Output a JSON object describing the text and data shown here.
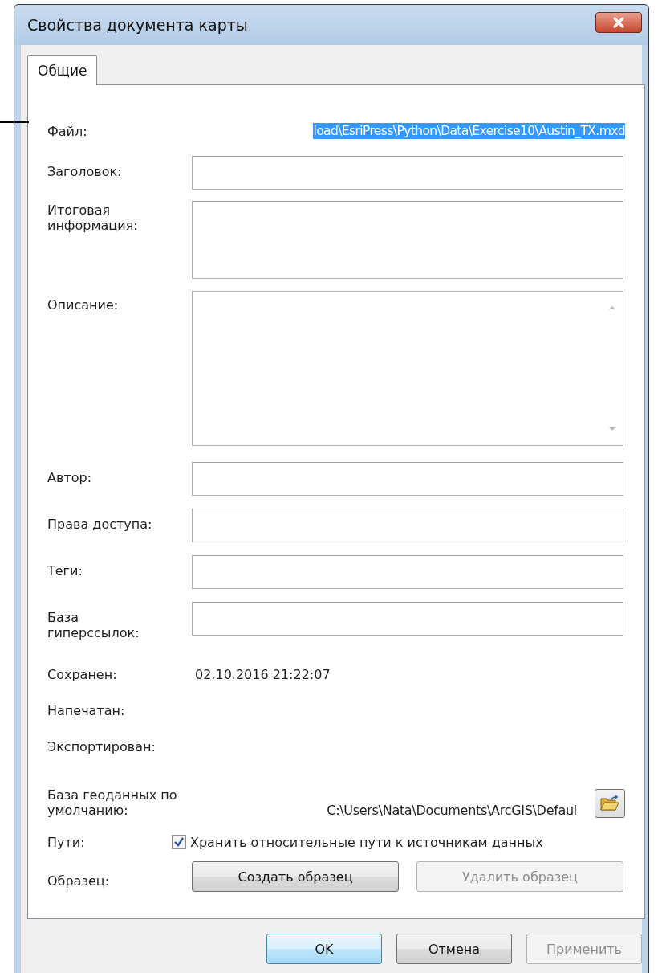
{
  "window": {
    "title": "Свойства документа карты"
  },
  "tabs": [
    {
      "label": "Общие",
      "selected": true
    }
  ],
  "fields": [
    {
      "kind": "selected-text",
      "label": "Файл:",
      "value": "load\\EsriPress\\Python\\Data\\Exercise10\\Austin_TX.mxd"
    },
    {
      "kind": "input",
      "label": "Заголовок:"
    },
    {
      "kind": "memo",
      "label": "Итоговая информация:"
    },
    {
      "kind": "textarea",
      "label": "Описание:"
    },
    {
      "kind": "input",
      "label": "Автор:"
    },
    {
      "kind": "input",
      "label": "Права доступа:"
    },
    {
      "kind": "input",
      "label": "Теги:"
    },
    {
      "kind": "input",
      "label": "База гиперссылок:"
    },
    {
      "kind": "static",
      "label": "Сохранен:",
      "value": "02.10.2016 21:22:07"
    },
    {
      "kind": "static",
      "label": "Напечатан:"
    },
    {
      "kind": "static",
      "label": "Экспортирован:"
    },
    {
      "kind": "path",
      "label": "База геоданных по умолчанию:",
      "value": "C:\\Users\\Nata\\Documents\\ArcGIS\\Defaul"
    },
    {
      "kind": "checkbox",
      "label": "Пути:",
      "text": "Хранить относительные пути к источникам данных",
      "checked": true
    },
    {
      "kind": "buttons",
      "label": "Образец:",
      "buttons": [
        {
          "label": "Создать образец",
          "disabled": false
        },
        {
          "label": "Удалить образец",
          "disabled": true
        }
      ]
    }
  ],
  "buttons": [
    {
      "label": "OK",
      "default": true,
      "disabled": false
    },
    {
      "label": "Отмена",
      "default": false,
      "disabled": false
    },
    {
      "label": "Применить",
      "default": false,
      "disabled": true
    }
  ]
}
